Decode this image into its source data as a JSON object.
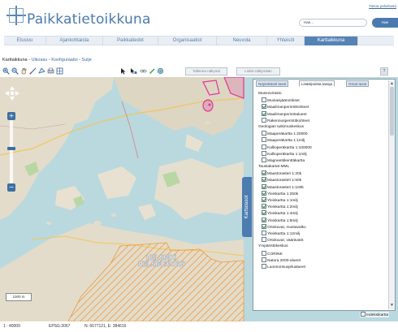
{
  "header": {
    "site_title": "Paikkatietoikkuna",
    "top_link": "Tietoa palvelusta",
    "search_value": "Hae...",
    "search_button": "Hae"
  },
  "nav": {
    "items": [
      "Etusivu",
      "Ajankohtaista",
      "Paikkatiedot",
      "Organisaatiot",
      "Neuvola",
      "Yhteisöt",
      "Karttaikkuna"
    ],
    "active": "Karttaikkuna"
  },
  "breadcrumb": {
    "page": "Karttaikkuna",
    "sep": " - ",
    "links": [
      "Ulkoasu",
      "Konfiguraatio",
      "Sulje"
    ]
  },
  "toolbar": {
    "save_view": "Tallenna näkymä",
    "link_view": "Linkki näkymään",
    "help": "?"
  },
  "map": {
    "place_label_1": "HELSINKI",
    "place_label_2": "HELSINGFORS",
    "scale_label": "1000 m",
    "side_tab": "Karttatasot",
    "index_map": "Indeksikartta",
    "colors": {
      "water": "#b9d9de",
      "land": "#e3dccb",
      "hatch": "#ee9a3a",
      "overlay": "#e0359a"
    }
  },
  "layers_panel": {
    "tabs": [
      "Näytettävät tasot",
      "Lisää/poista tasoja",
      "Omat tasot"
    ],
    "active_tab": "Lisää/poista tasoja",
    "rows": [
      {
        "type": "group",
        "label": "Museovirasto"
      },
      {
        "type": "item",
        "label": "Muinaisjäännökset",
        "checked": false
      },
      {
        "type": "item",
        "label": "Maailmanperintökohteet",
        "checked": true
      },
      {
        "type": "item",
        "label": "Maailmanperintöalueet",
        "checked": true
      },
      {
        "type": "item",
        "label": "Rakennusperintökohteet",
        "checked": false
      },
      {
        "type": "group",
        "label": "Geologian tutkimuskeskus"
      },
      {
        "type": "item",
        "label": "Maaperäkartta 1:20000",
        "checked": false
      },
      {
        "type": "item",
        "label": "Maaperäkartta 1:1milj",
        "checked": false
      },
      {
        "type": "item",
        "label": "Kallioperäkartta 1:100000",
        "checked": false
      },
      {
        "type": "item",
        "label": "Kallioperäkartta 1:1milj",
        "checked": false
      },
      {
        "type": "item",
        "label": "Magneettikenttäkartta",
        "checked": false
      },
      {
        "type": "group",
        "label": "Taustakartat MML"
      },
      {
        "type": "item",
        "label": "Maastorasteri 1:20k",
        "checked": true
      },
      {
        "type": "item",
        "label": "Maastorasteri 1:50k",
        "checked": true
      },
      {
        "type": "item",
        "label": "Maastorasteri 1:100k",
        "checked": true
      },
      {
        "type": "item",
        "label": "Yleiskartta 1:250k",
        "checked": true
      },
      {
        "type": "item",
        "label": "Yleiskartta 1:1milj",
        "checked": true
      },
      {
        "type": "item",
        "label": "Yleiskartta 1:2milj",
        "checked": true
      },
      {
        "type": "item",
        "label": "Yleiskartta 1:4milj",
        "checked": true
      },
      {
        "type": "item",
        "label": "Yleiskartta 1:8milj",
        "checked": true
      },
      {
        "type": "item",
        "label": "Ortokuvat, mustavalko",
        "checked": true
      },
      {
        "type": "item",
        "label": "Yleiskartta 1:12milj",
        "checked": false
      },
      {
        "type": "item",
        "label": "Ortokuvat, väärävärit",
        "checked": false
      },
      {
        "type": "group",
        "label": "Ympäristökeskus"
      },
      {
        "type": "item",
        "label": "CORINE",
        "checked": false
      },
      {
        "type": "item",
        "label": "Natura 2000-alueet",
        "checked": false
      },
      {
        "type": "item",
        "label": "Luonnonsuojelualueet",
        "checked": false
      }
    ]
  },
  "status": {
    "scale": "1 : 40000",
    "projection": "EPSG:3067",
    "coords": "N: 6677121, E: 384616"
  }
}
